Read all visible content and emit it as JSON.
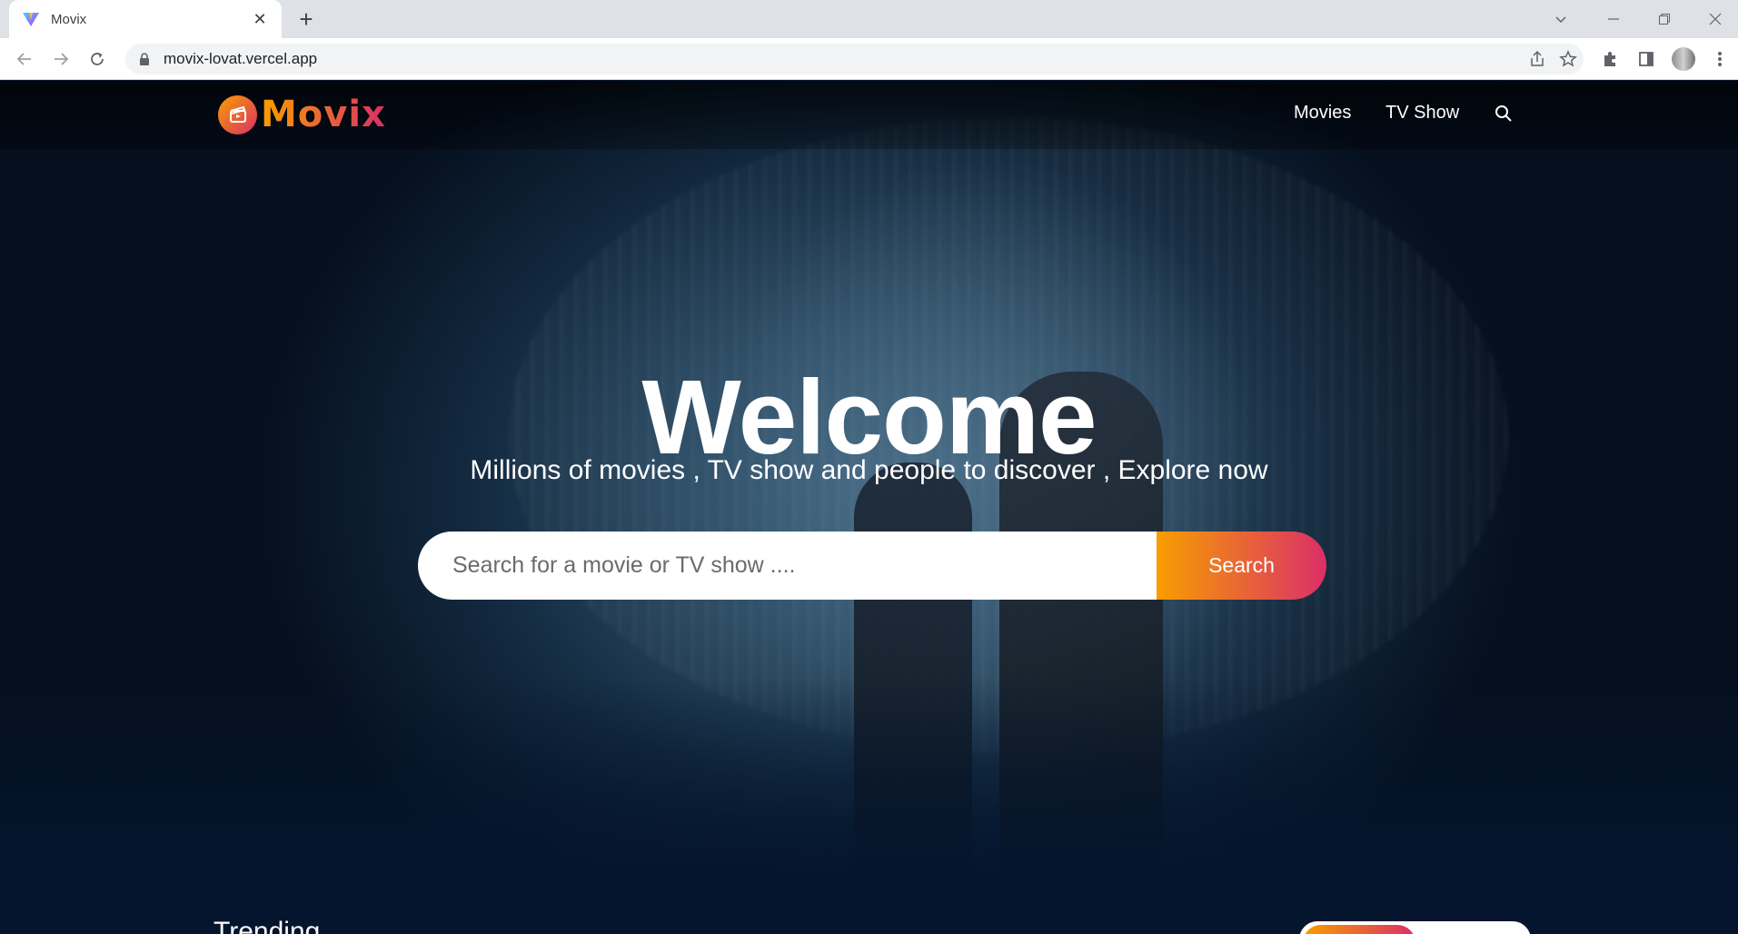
{
  "browser": {
    "tab_title": "Movix",
    "url": "movix-lovat.vercel.app"
  },
  "header": {
    "logo_text": "Movix",
    "menu": [
      "Movies",
      "TV Show"
    ]
  },
  "hero": {
    "title": "Welcome",
    "subtitle": "Millions of movies , TV show and people to discover , Explore now",
    "search_placeholder": "Search for a movie or TV show ....",
    "search_button": "Search"
  },
  "trending": {
    "title": "Trending"
  },
  "colors": {
    "accent_start": "#f89e00",
    "accent_end": "#da2f68",
    "background": "#04152d"
  }
}
